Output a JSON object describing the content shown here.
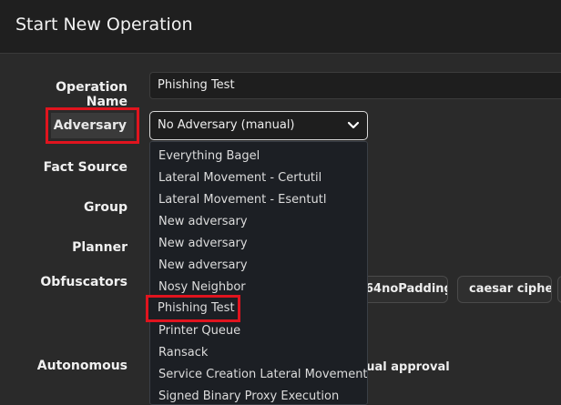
{
  "header": {
    "title": "Start New Operation"
  },
  "form": {
    "labels": {
      "operation_name": "Operation Name",
      "adversary": "Adversary",
      "fact_source": "Fact Source",
      "group": "Group",
      "planner": "Planner",
      "obfuscators": "Obfuscators",
      "autonomous": "Autonomous"
    },
    "operation_name_value": "Phishing Test",
    "adversary_selected": "No Adversary (manual)",
    "obfuscator_options": [
      "64noPadding",
      "caesar cipher"
    ],
    "autonomous_option_partial": "nual approval"
  },
  "dropdown": {
    "items": [
      "Everything Bagel",
      "Lateral Movement - Certutil",
      "Lateral Movement - Esentutl",
      "New adversary",
      "New adversary",
      "New adversary",
      "Nosy Neighbor",
      "Phishing Test",
      "Printer Queue",
      "Ransack",
      "Service Creation Lateral Movement",
      "Signed Binary Proxy Execution"
    ],
    "highlighted_index": 7
  },
  "colors": {
    "highlight": "#e0141e"
  }
}
